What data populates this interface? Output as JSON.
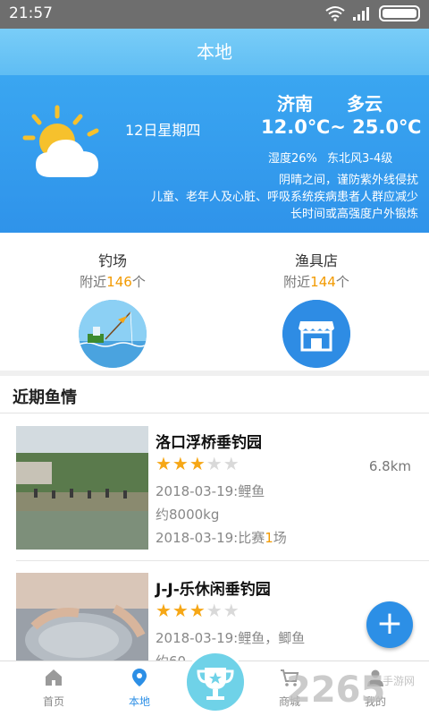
{
  "status_bar": {
    "time": "21:57"
  },
  "app_bar": {
    "title": "本地"
  },
  "weather": {
    "date": "12日星期四",
    "city": "济南",
    "condition": "多云",
    "temperature": "12.0℃~ 25.0℃",
    "humidity": "湿度26%",
    "wind": "东北风3-4级",
    "advice_line1": "阴晴之间，谨防紫外线侵扰",
    "advice_line2": "儿童、老年人及心脏、呼吸系统疾病患者人群应减少",
    "advice_line3": "长时间或高强度户外锻炼"
  },
  "shops": {
    "fishing": {
      "name": "钓场",
      "near_prefix": "附近",
      "count": "146",
      "suffix": "个"
    },
    "tackle": {
      "name": "渔具店",
      "near_prefix": "附近",
      "count": "144",
      "suffix": "个"
    }
  },
  "section": {
    "title": "近期鱼情"
  },
  "items": [
    {
      "name": "洛口浮桥垂钓园",
      "rating": 3,
      "distance": "6.8km",
      "line1": "2018-03-19:鲤鱼",
      "line2": "约8000kg",
      "line3_prefix": "2018-03-19:比赛",
      "line3_count": "1",
      "line3_suffix": "场"
    },
    {
      "name": "J-J-乐休闲垂钓园",
      "rating": 3,
      "line1": "2018-03-19:鲤鱼，鲫鱼",
      "line2": "约60"
    }
  ],
  "tabs": [
    {
      "label": "首页",
      "icon": "home-icon"
    },
    {
      "label": "本地",
      "icon": "location-icon"
    },
    {
      "label": "",
      "icon": "trophy-icon"
    },
    {
      "label": "商城",
      "icon": "cart-icon"
    },
    {
      "label": "我的",
      "icon": "user-icon"
    }
  ],
  "watermark": {
    "text": "2265",
    "sub": "手游网"
  },
  "colors": {
    "primary": "#2c8fe6",
    "accent": "#f29a00",
    "star": "#f6a716"
  }
}
